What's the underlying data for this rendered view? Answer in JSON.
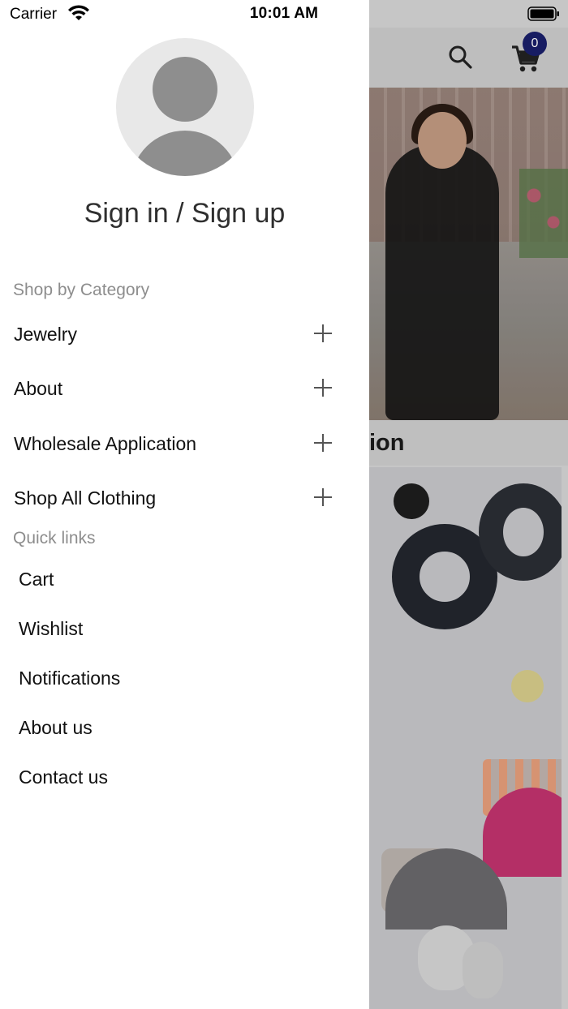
{
  "status_bar": {
    "carrier": "Carrier",
    "time": "10:01 AM"
  },
  "drawer": {
    "signin_label": "Sign in / Sign up",
    "shop_by_category_label": "Shop by Category",
    "categories": [
      {
        "label": "Jewelry",
        "icon": "plus-icon"
      },
      {
        "label": "About",
        "icon": "plus-icon"
      },
      {
        "label": "Wholesale Application",
        "icon": "plus-icon"
      },
      {
        "label": "Shop All Clothing",
        "icon": "plus-icon"
      }
    ],
    "quick_links_label": "Quick links",
    "quick_links": [
      "Cart",
      "Wishlist",
      "Notifications",
      "About us",
      "Contact us"
    ]
  },
  "background": {
    "cart_count": "0",
    "section_title_fragment": "ion"
  },
  "colors": {
    "cart_badge": "#1a1f6b",
    "avatar_bg": "#e8e8e8",
    "avatar_fg": "#8e8e8e",
    "section_label": "#8d8d8d"
  }
}
